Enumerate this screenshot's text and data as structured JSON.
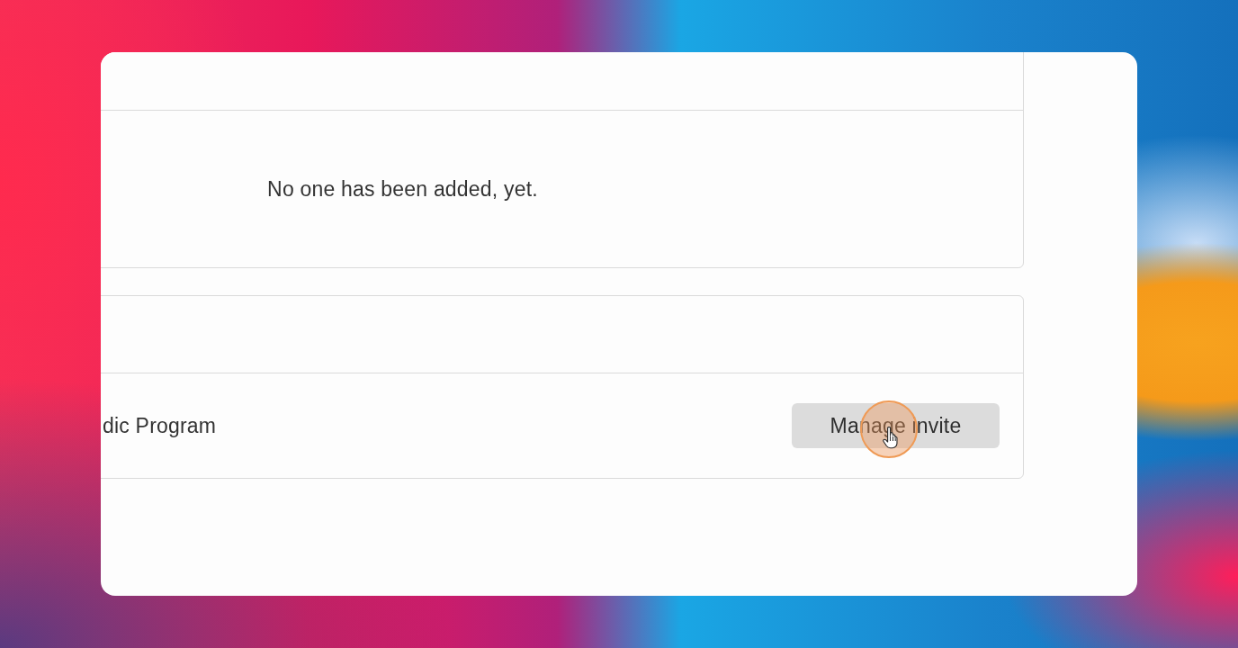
{
  "members_panel": {
    "empty_message": "No one has been added, yet."
  },
  "programs_panel": {
    "rows": [
      {
        "name": "dic Program",
        "action": "Manage invite"
      }
    ]
  }
}
